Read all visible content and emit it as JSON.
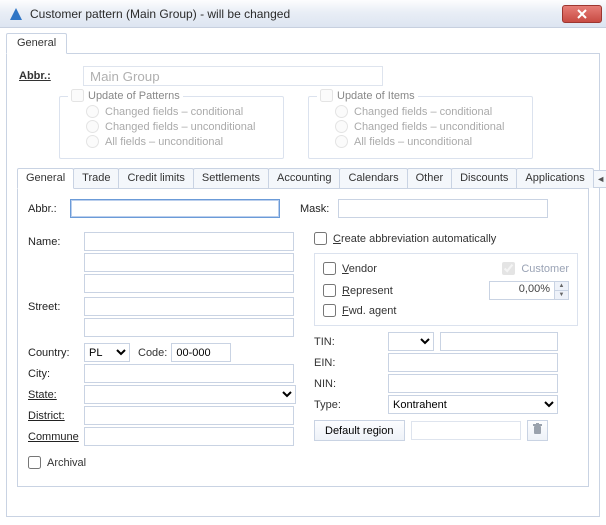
{
  "window": {
    "title": "Customer pattern (Main Group) - will be changed"
  },
  "outer_tabs": [
    {
      "label": "General"
    }
  ],
  "sidebar_icons": {
    "save": "save-icon",
    "delete": "delete-icon"
  },
  "top": {
    "abbr_label": "Abbr.:",
    "abbr_value": "Main Group"
  },
  "update_patterns": {
    "legend": "Update of Patterns",
    "options": [
      "Changed fields – conditional",
      "Changed fields – unconditional",
      "All fields – unconditional"
    ],
    "checked": false,
    "selected": null
  },
  "update_items": {
    "legend": "Update of Items",
    "options": [
      "Changed fields – conditional",
      "Changed fields – unconditional",
      "All fields – unconditional"
    ],
    "checked": false,
    "selected": null
  },
  "inner_tabs": {
    "items": [
      "General",
      "Trade",
      "Credit limits",
      "Settlements",
      "Accounting",
      "Calendars",
      "Other",
      "Discounts",
      "Applications"
    ],
    "active_index": 0
  },
  "general": {
    "abbr_label": "Abbr.:",
    "abbr_value": "",
    "mask_label": "Mask:",
    "mask_value": "",
    "name_label": "Name:",
    "name1": "",
    "name2": "",
    "name3": "",
    "street_label": "Street:",
    "street1": "",
    "street2": "",
    "country_label": "Country:",
    "country_value": "PL",
    "code_label": "Code:",
    "code_value": "00-000",
    "city_label": "City:",
    "city_value": "",
    "state_label": "State:",
    "state_value": "",
    "district_label": "District:",
    "district_value": "",
    "commune_label": "Commune",
    "commune_value": "",
    "archival_label": "Archival",
    "archival_checked": false,
    "auto_abbr_label": "Create abbreviation automatically",
    "auto_abbr_checked": false,
    "vendor_label": "Vendor",
    "vendor_checked": false,
    "customer_label": "Customer",
    "customer_checked": true,
    "represent_label": "Represent",
    "represent_checked": false,
    "represent_pct": "0,00%",
    "fwd_agent_label": "Fwd. agent",
    "fwd_agent_checked": false,
    "tin_label": "TIN:",
    "tin_prefix": "",
    "tin_value": "",
    "ein_label": "EIN:",
    "ein_value": "",
    "nin_label": "NIN:",
    "nin_value": "",
    "type_label": "Type:",
    "type_value": "Kontrahent",
    "default_region_btn": "Default region",
    "default_region_value": ""
  }
}
